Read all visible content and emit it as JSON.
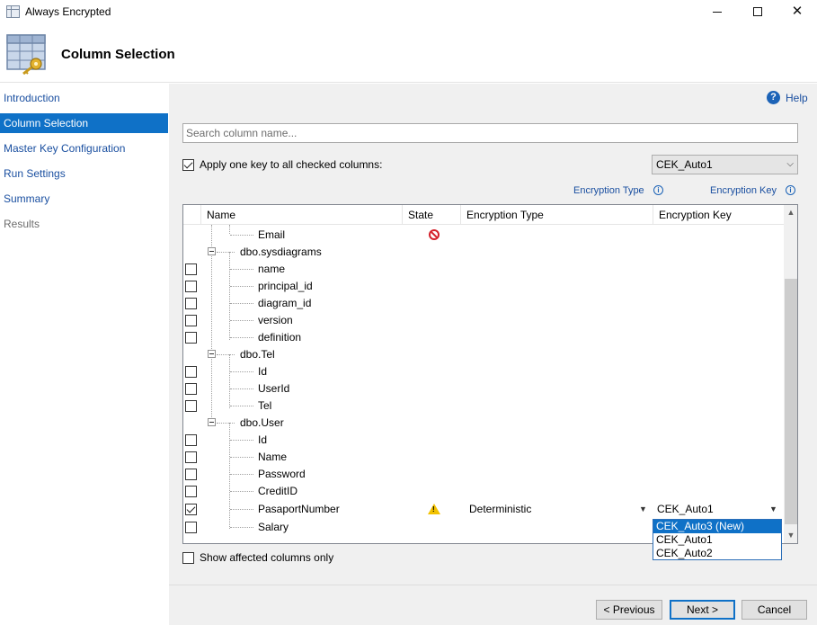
{
  "window": {
    "title": "Always Encrypted",
    "minimize": "",
    "maximize": "",
    "close": "✕"
  },
  "header": {
    "title": "Column Selection"
  },
  "sidebar": {
    "items": [
      {
        "label": "Introduction"
      },
      {
        "label": "Column Selection"
      },
      {
        "label": "Master Key Configuration"
      },
      {
        "label": "Run Settings"
      },
      {
        "label": "Summary"
      },
      {
        "label": "Results"
      }
    ]
  },
  "help": {
    "label": "Help",
    "icon": "?"
  },
  "search": {
    "placeholder": "Search column name..."
  },
  "apply": {
    "label": "Apply one key to all checked columns:",
    "checked": true,
    "key_value": "CEK_Auto1"
  },
  "labels": {
    "encryption_type": "Encryption Type",
    "encryption_key": "Encryption Key",
    "info": "i"
  },
  "grid": {
    "columns": [
      "Name",
      "State",
      "Encryption Type",
      "Encryption Key"
    ],
    "rows": [
      {
        "name": "Email",
        "level": 2,
        "checkbox": false
      },
      {
        "name": "dbo.sysdiagrams",
        "level": 1,
        "checkbox": false
      },
      {
        "name": "name",
        "level": 2,
        "checkbox": true
      },
      {
        "name": "principal_id",
        "level": 2,
        "checkbox": true
      },
      {
        "name": "diagram_id",
        "level": 2,
        "checkbox": true
      },
      {
        "name": "version",
        "level": 2,
        "checkbox": true
      },
      {
        "name": "definition",
        "level": 2,
        "checkbox": true
      },
      {
        "name": "dbo.Tel",
        "level": 1,
        "checkbox": false
      },
      {
        "name": "Id",
        "level": 2,
        "checkbox": true
      },
      {
        "name": "UserId",
        "level": 2,
        "checkbox": true
      },
      {
        "name": "Tel",
        "level": 2,
        "checkbox": true
      },
      {
        "name": "dbo.User",
        "level": 1,
        "checkbox": false
      },
      {
        "name": "Id",
        "level": 2,
        "checkbox": true
      },
      {
        "name": "Name",
        "level": 2,
        "checkbox": true
      },
      {
        "name": "Password",
        "level": 2,
        "checkbox": true
      },
      {
        "name": "CreditID",
        "level": 2,
        "checkbox": true
      },
      {
        "name": "PasaportNumber",
        "level": 2,
        "checkbox": true
      },
      {
        "name": "Salary",
        "level": 2,
        "checkbox": true
      }
    ],
    "pasaport_type": "Deterministic",
    "pasaport_key": "CEK_Auto1",
    "dropdown_options": [
      "CEK_Auto3 (New)",
      "CEK_Auto1",
      "CEK_Auto2"
    ]
  },
  "show_affected": {
    "label": "Show affected columns only",
    "checked": false
  },
  "buttons": {
    "previous": "< Previous",
    "next": "Next >",
    "cancel": "Cancel"
  },
  "colors": {
    "accent": "#0f71c7",
    "link": "#1a4fa0",
    "panel_bg": "#f0f0f0"
  }
}
